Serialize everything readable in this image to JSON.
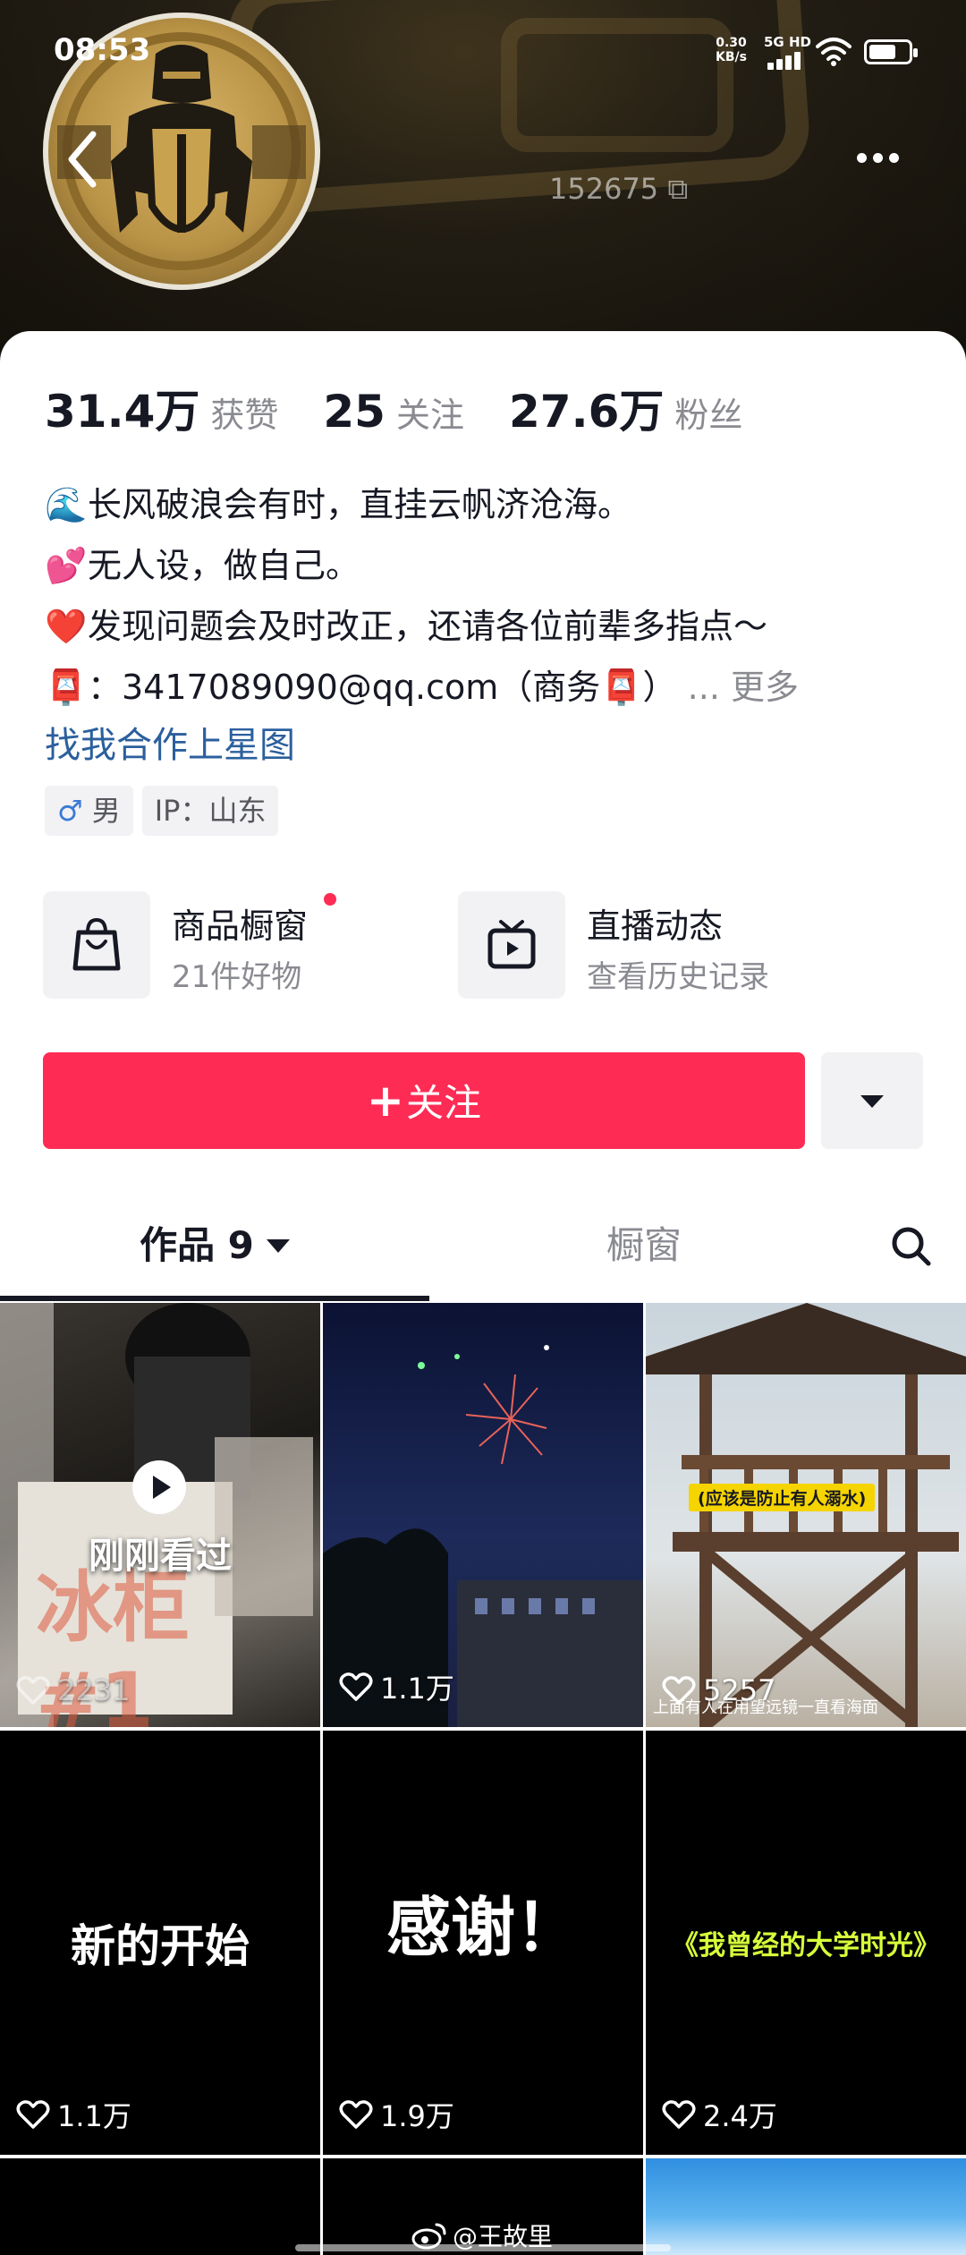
{
  "status_bar": {
    "time": "08:53",
    "net_speed_value": "0.30",
    "net_speed_unit": "KB/s",
    "network": "5G HD",
    "battery_level": 0.7
  },
  "header": {
    "uid_fragment": "152675"
  },
  "stats": {
    "likes_count": "31.4万",
    "likes_label": "获赞",
    "following_count": "25",
    "following_label": "关注",
    "followers_count": "27.6万",
    "followers_label": "粉丝"
  },
  "bio": {
    "line1_emoji": "🌊",
    "line1": "长风破浪会有时，直挂云帆济沧海。",
    "line2_emoji": "💕",
    "line2": "无人设，做自己。",
    "line3_emoji": "❤️",
    "line3": "发现问题会及时改正，还请各位前辈多指点～",
    "line4_emoji": "📮",
    "line4": "：3417089090@qq.com（商务📮）",
    "ellipsis": "...",
    "more": "更多",
    "collab_link": "找我合作上星图"
  },
  "tags": {
    "gender_symbol": "♂",
    "gender": "男",
    "ip": "IP：山东"
  },
  "features": {
    "shop_title": "商品橱窗",
    "shop_sub": "21件好物",
    "live_title": "直播动态",
    "live_sub": "查看历史记录"
  },
  "actions": {
    "follow_plus": "+",
    "follow_label": "关注"
  },
  "tabs": {
    "works_label": "作品 9",
    "window_label": "橱窗"
  },
  "grid": {
    "items": [
      {
        "likes": "2231",
        "overlay": "刚刚看过",
        "bg_text": "冰柜 #1"
      },
      {
        "likes": "1.1万"
      },
      {
        "likes": "5257",
        "caption": "(应该是防止有人溺水)",
        "subtitle": "上面有人在用望远镜一直看海面"
      },
      {
        "likes": "1.1万",
        "title": "新的开始"
      },
      {
        "likes": "1.9万",
        "title": "感谢！"
      },
      {
        "likes": "2.4万",
        "title": "《我曾经的大学时光》"
      }
    ]
  },
  "watermark": "@王故里",
  "colors": {
    "accent": "#fe2c55",
    "link": "#2b5f9d",
    "secondary_text": "#8a8b91"
  }
}
